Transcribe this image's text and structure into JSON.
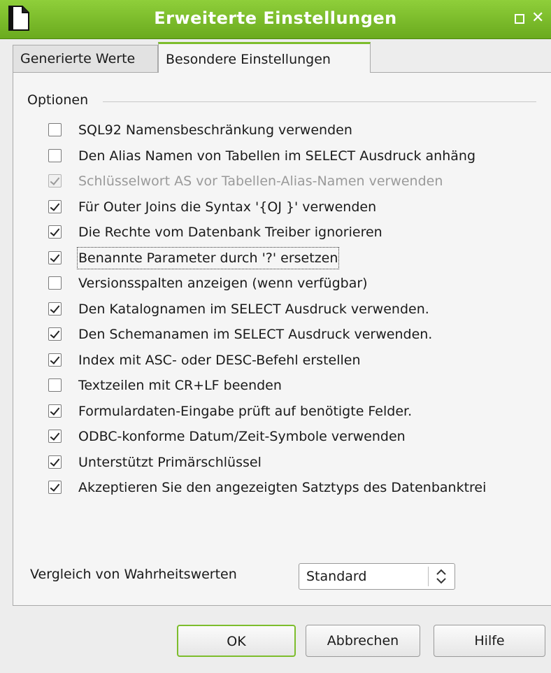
{
  "window": {
    "title": "Erweiterte Einstellungen",
    "close_glyph": "✕",
    "accent": "#7dbd2c"
  },
  "tabs": [
    {
      "label": "Generierte Werte",
      "selected": false
    },
    {
      "label": "Besondere Einstellungen",
      "selected": true
    }
  ],
  "group": {
    "label": "Optionen"
  },
  "options": [
    {
      "label": "SQL92 Namensbeschränkung verwenden",
      "checked": false,
      "enabled": true
    },
    {
      "label": "Den Alias Namen von Tabellen im SELECT Ausdruck anhäng",
      "checked": false,
      "enabled": true
    },
    {
      "label": "Schlüsselwort AS vor Tabellen-Alias-Namen verwenden",
      "checked": true,
      "enabled": false
    },
    {
      "label": "Für Outer Joins die Syntax '{OJ }' verwenden",
      "checked": true,
      "enabled": true
    },
    {
      "label": "Die Rechte vom Datenbank Treiber ignorieren",
      "checked": true,
      "enabled": true
    },
    {
      "label": "Benannte Parameter durch '?' ersetzen",
      "checked": true,
      "enabled": true,
      "focused": true
    },
    {
      "label": "Versionsspalten anzeigen (wenn verfügbar)",
      "checked": false,
      "enabled": true
    },
    {
      "label": "Den Katalognamen im SELECT Ausdruck verwenden.",
      "checked": true,
      "enabled": true
    },
    {
      "label": "Den Schemanamen im SELECT Ausdruck verwenden.",
      "checked": true,
      "enabled": true
    },
    {
      "label": "Index mit ASC- oder DESC-Befehl erstellen",
      "checked": true,
      "enabled": true
    },
    {
      "label": "Textzeilen mit CR+LF beenden",
      "checked": false,
      "enabled": true
    },
    {
      "label": "Formulardaten-Eingabe prüft auf benötigte Felder.",
      "checked": true,
      "enabled": true
    },
    {
      "label": "ODBC-konforme Datum/Zeit-Symbole verwenden",
      "checked": true,
      "enabled": true
    },
    {
      "label": "Unterstützt Primärschlüssel",
      "checked": true,
      "enabled": true
    },
    {
      "label": "Akzeptieren Sie den angezeigten Satztyps des Datenbanktrei",
      "checked": true,
      "enabled": true
    }
  ],
  "comparison": {
    "label": "Vergleich von Wahrheitswerten",
    "value": "Standard"
  },
  "buttons": {
    "ok": "OK",
    "cancel": "Abbrechen",
    "help": "Hilfe"
  }
}
